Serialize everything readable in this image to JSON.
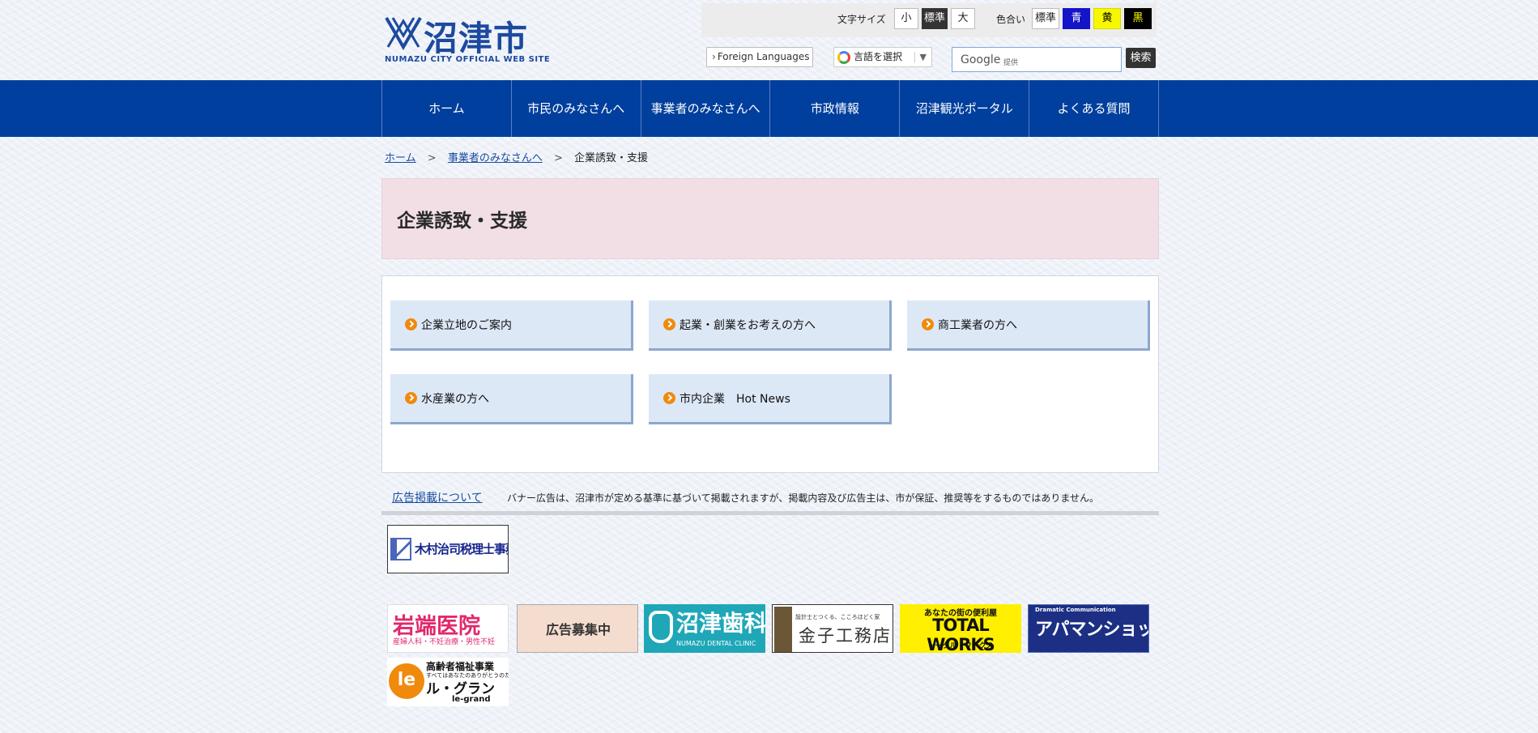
{
  "header": {
    "logo_text": "沼津市",
    "logo_sub": "NUMAZU CITY OFFICIAL WEB SITE",
    "font_size_label": "文字サイズ",
    "font_sizes": [
      "小",
      "標準",
      "大"
    ],
    "color_label": "色合い",
    "colors": [
      "標準",
      "青",
      "黄",
      "黒"
    ],
    "foreign_languages": "Foreign Languages",
    "translate_label": "言語を選択",
    "translate_arrow": "▼",
    "search_brand": "Google",
    "search_provided": "提供",
    "search_button": "検索"
  },
  "nav": {
    "items": [
      "ホーム",
      "市民のみなさんへ",
      "事業者のみなさんへ",
      "市政情報",
      "沼津観光ポータル",
      "よくある質問"
    ]
  },
  "breadcrumb": {
    "items": [
      "ホーム",
      "事業者のみなさんへ"
    ],
    "current": "企業誘致・支援",
    "separator": ">"
  },
  "page": {
    "title": "企業誘致・支援"
  },
  "tiles": [
    "企業立地のご案内",
    "起業・創業をお考えの方へ",
    "商工業者の方へ",
    "水産業の方へ",
    "市内企業　Hot News"
  ],
  "ads": {
    "link": "広告掲載について",
    "notice": "バナー広告は、沼津市が定める基準に基づいて掲載されますが、掲載内容及び広告主は、市が保証、推奨等をするものではありません。",
    "banners": {
      "kimura": "木村治司税理士事務所",
      "iwabata_name": "岩端医院",
      "iwabata_sub": "産婦人科・不妊治療・男性不妊",
      "recruit": "広告募集中",
      "dental_name": "沼津歯科",
      "dental_sub": "NUMAZU DENTAL CLINIC",
      "kane_small": "設計士とつくる、こころほどく家",
      "kane_name": "金子工務店",
      "total_top": "あなたの街の便利屋",
      "total_name": "TOTAL WORKS",
      "total_sub": "トータル・ワークス",
      "apaman_top": "Dramatic Communication",
      "apaman_name": "アパマンショップ",
      "legrand_l1": "高齢者福祉事業",
      "legrand_l2": "すべてはあなたのありがとうのために",
      "legrand_l3": "ル・グラン",
      "legrand_l4": "le-grand"
    }
  },
  "colors": {
    "nav_bg": "#003f9d",
    "title_bg": "#f1dfe5",
    "tile_bg": "#dde8f7",
    "bullet": "#f08a0d"
  }
}
